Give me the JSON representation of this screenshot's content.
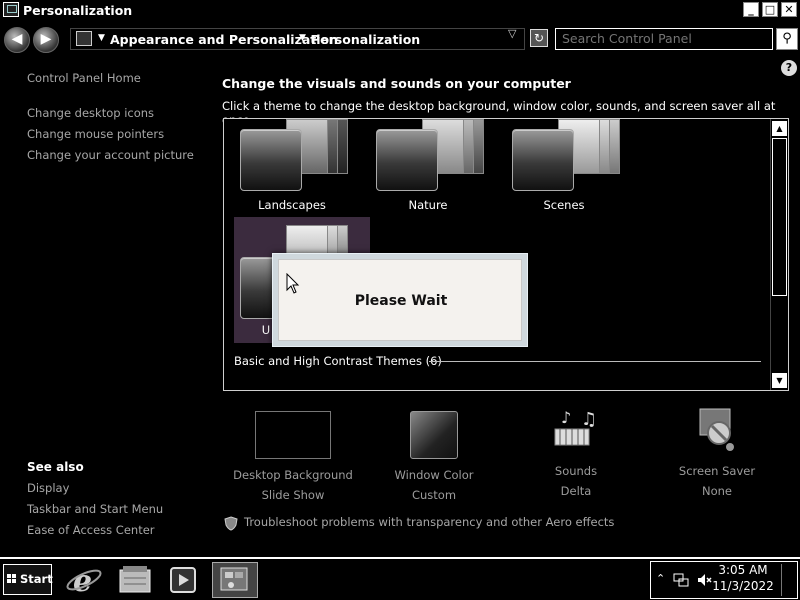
{
  "window": {
    "title": "Personalization",
    "min_glyph": "0",
    "max_glyph": "1",
    "close_glyph": "X"
  },
  "address": {
    "breadcrumbs": [
      "Appearance and Personalization",
      "Personalization"
    ],
    "search_placeholder": "Search Control Panel"
  },
  "sidebar": {
    "home": "Control Panel Home",
    "tasks": [
      "Change desktop icons",
      "Change mouse pointers",
      "Change your account picture"
    ],
    "see_also_title": "See also",
    "see_also": [
      "Display",
      "Taskbar and Start Menu",
      "Ease of Access Center"
    ]
  },
  "main": {
    "heading": "Change the visuals and sounds on your computer",
    "subheading": "Click a theme to change the desktop background, window color, sounds, and screen saver all at once.",
    "themes": [
      {
        "label": "Landscapes"
      },
      {
        "label": "Nature"
      },
      {
        "label": "Scenes"
      },
      {
        "label": "U"
      }
    ],
    "group_title": "Basic and High Contrast Themes (6)"
  },
  "dialog": {
    "text": "Please Wait"
  },
  "settings": [
    {
      "title": "Desktop Background",
      "value": "Slide Show",
      "icon": "desktop-background-icon"
    },
    {
      "title": "Window Color",
      "value": "Custom",
      "icon": "window-color-icon"
    },
    {
      "title": "Sounds",
      "value": "Delta",
      "icon": "sounds-icon"
    },
    {
      "title": "Screen Saver",
      "value": "None",
      "icon": "screen-saver-icon"
    }
  ],
  "troubleshoot": "Troubleshoot problems with transparency and other Aero effects",
  "taskbar": {
    "start_label": "Start",
    "time": "3:05 AM",
    "date": "11/3/2022"
  },
  "colors": {
    "background": "#000000",
    "link_gray": "#a7a7a7",
    "selected_theme": "#3b2b3e",
    "dialog_bg": "#f4f2ee"
  }
}
